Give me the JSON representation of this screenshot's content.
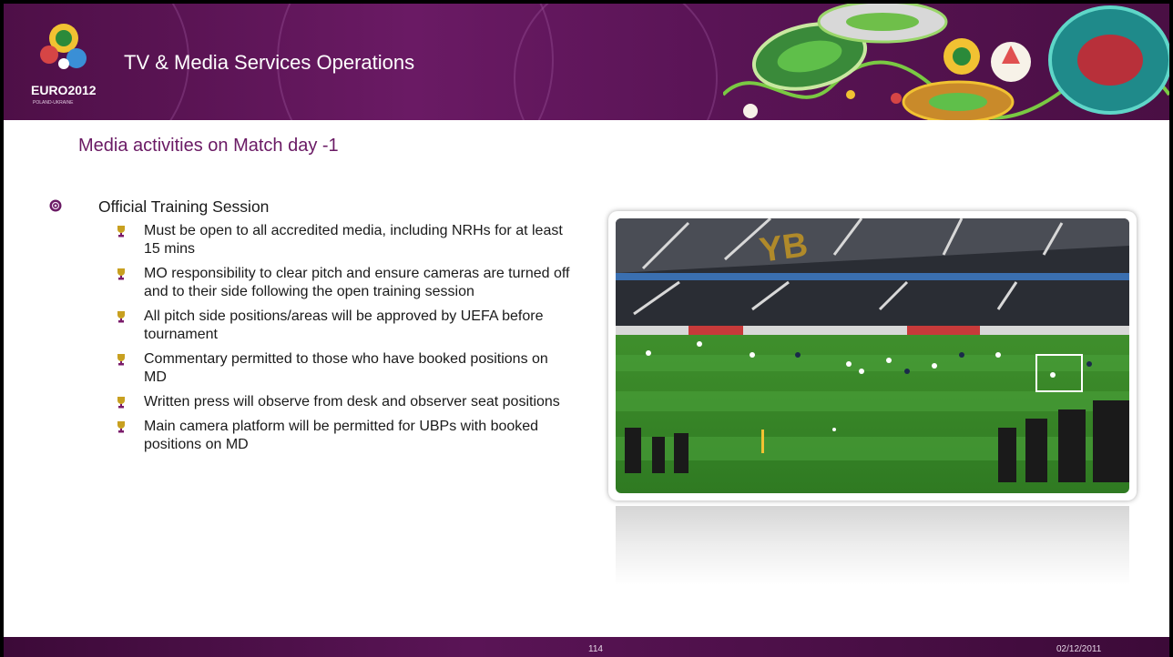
{
  "header": {
    "title": "TV & Media Services Operations",
    "logo_text": "EURO2012",
    "logo_subtext": "POLAND-UKRAINE"
  },
  "slide": {
    "title": "Media activities on Match day -1",
    "bullets": [
      {
        "text": "Official Training Session",
        "children": [
          "Must be open to all accredited media, including NRHs for at least 15 mins",
          "MO responsibility to clear pitch and ensure cameras are turned off and to their side following the open training session",
          "All pitch side positions/areas will be approved by UEFA before tournament",
          "Commentary permitted to those who have booked positions on MD",
          "Written press will observe from desk and observer seat positions",
          "Main camera platform will be permitted for UBPs with booked positions on MD"
        ]
      }
    ]
  },
  "photo": {
    "stand_text": "YB"
  },
  "footer": {
    "page_number": "114",
    "date": "02/12/2011"
  },
  "colors": {
    "brand_purple": "#6a1a64",
    "bullet_gold": "#c8a020"
  }
}
